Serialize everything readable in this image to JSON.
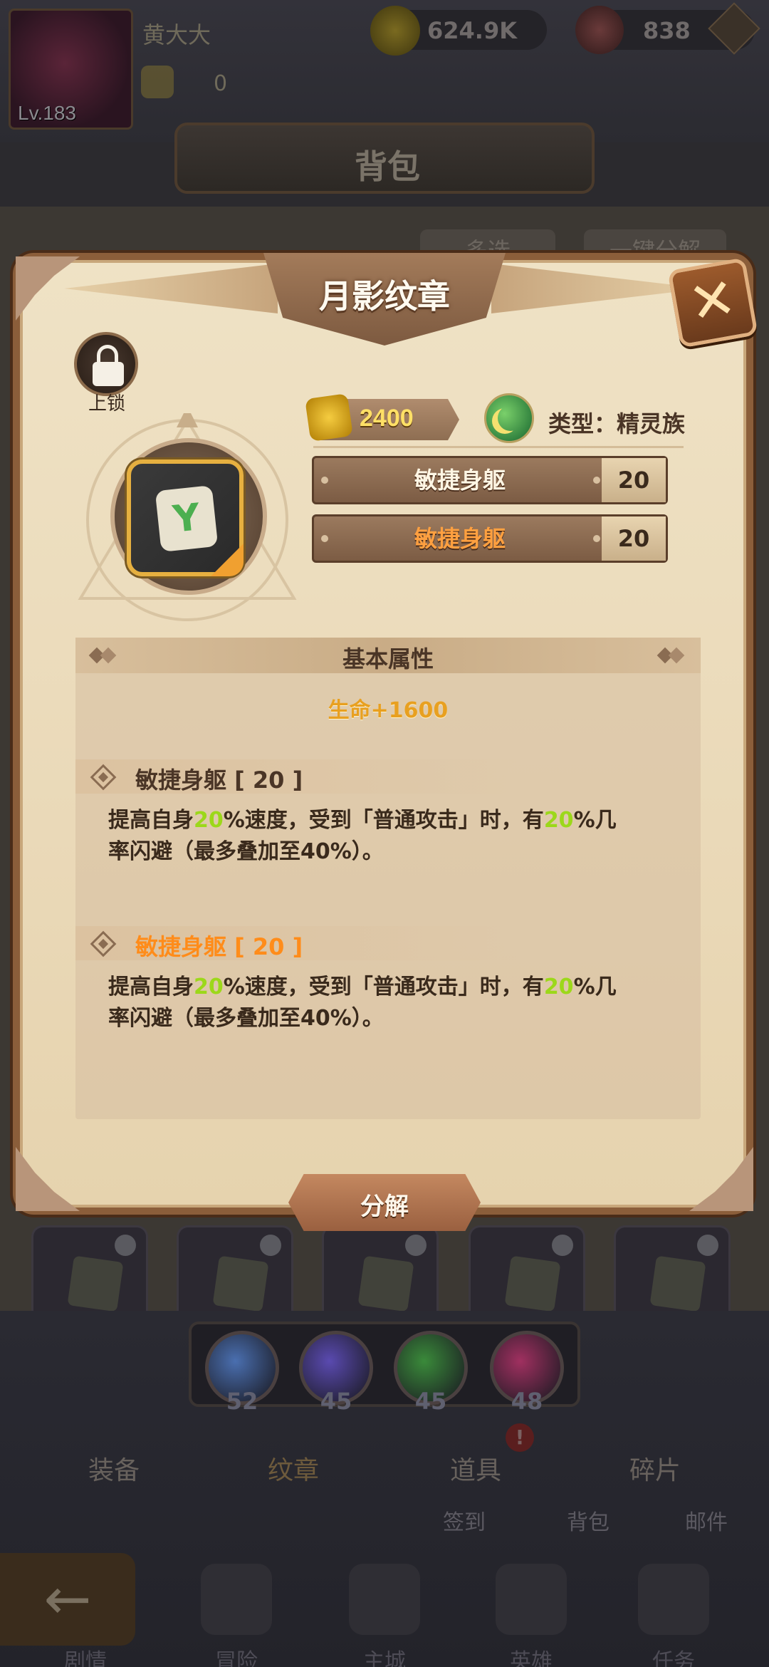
{
  "player": {
    "name": "黄大大",
    "level": "Lv.183",
    "stamina": "0"
  },
  "currency": {
    "coins": "624.9K",
    "gems": "838"
  },
  "bag": {
    "title": "背包",
    "multi_select": "多选",
    "one_key_decompose": "一键分解"
  },
  "modal": {
    "title": "月影纹章",
    "lock_label": "上锁",
    "cost": "2400",
    "type_label": "类型：精灵族",
    "skills": [
      {
        "name": "敏捷身躯",
        "value": "20"
      },
      {
        "name": "敏捷身躯",
        "value": "20"
      }
    ],
    "basic_header": "基本属性",
    "life_stat": "生命+1600",
    "effects": [
      {
        "title": "敏捷身躯 [ 20 ]",
        "desc_a": "提高自身",
        "hl_a": "20",
        "desc_b": "%速度，受到「普通攻击」时，有",
        "hl_b": "20",
        "desc_c": "%几",
        "desc_line2": "率闪避（最多叠加至40%）。"
      },
      {
        "title": "敏捷身躯 [ 20 ]",
        "desc_a": "提高自身",
        "hl_a": "20",
        "desc_b": "%速度，受到「普通攻击」时，有",
        "hl_b": "20",
        "desc_c": "%几",
        "desc_line2": "率闪避（最多叠加至40%）。"
      }
    ],
    "decompose": "分解",
    "close_icon": "close-icon"
  },
  "races": [
    {
      "icon": "crown-icon",
      "count": "52",
      "color": "#4a6fb0"
    },
    {
      "icon": "flame-icon",
      "count": "45",
      "color": "#5a4ab0"
    },
    {
      "icon": "moon-icon",
      "count": "45",
      "color": "#3a8a3a"
    },
    {
      "icon": "eye-icon",
      "count": "48",
      "color": "#a03060"
    }
  ],
  "tabs": [
    {
      "label": "装备"
    },
    {
      "label": "纹章"
    },
    {
      "label": "道具"
    },
    {
      "label": "碎片"
    }
  ],
  "sub_labels": {
    "signin": "签到",
    "bag": "背包",
    "mail": "邮件"
  },
  "alert": "!",
  "bottom_nav": [
    {
      "label": "剧情"
    },
    {
      "label": "冒险"
    },
    {
      "label": "主城"
    },
    {
      "label": "英雄"
    },
    {
      "label": "任务"
    }
  ]
}
